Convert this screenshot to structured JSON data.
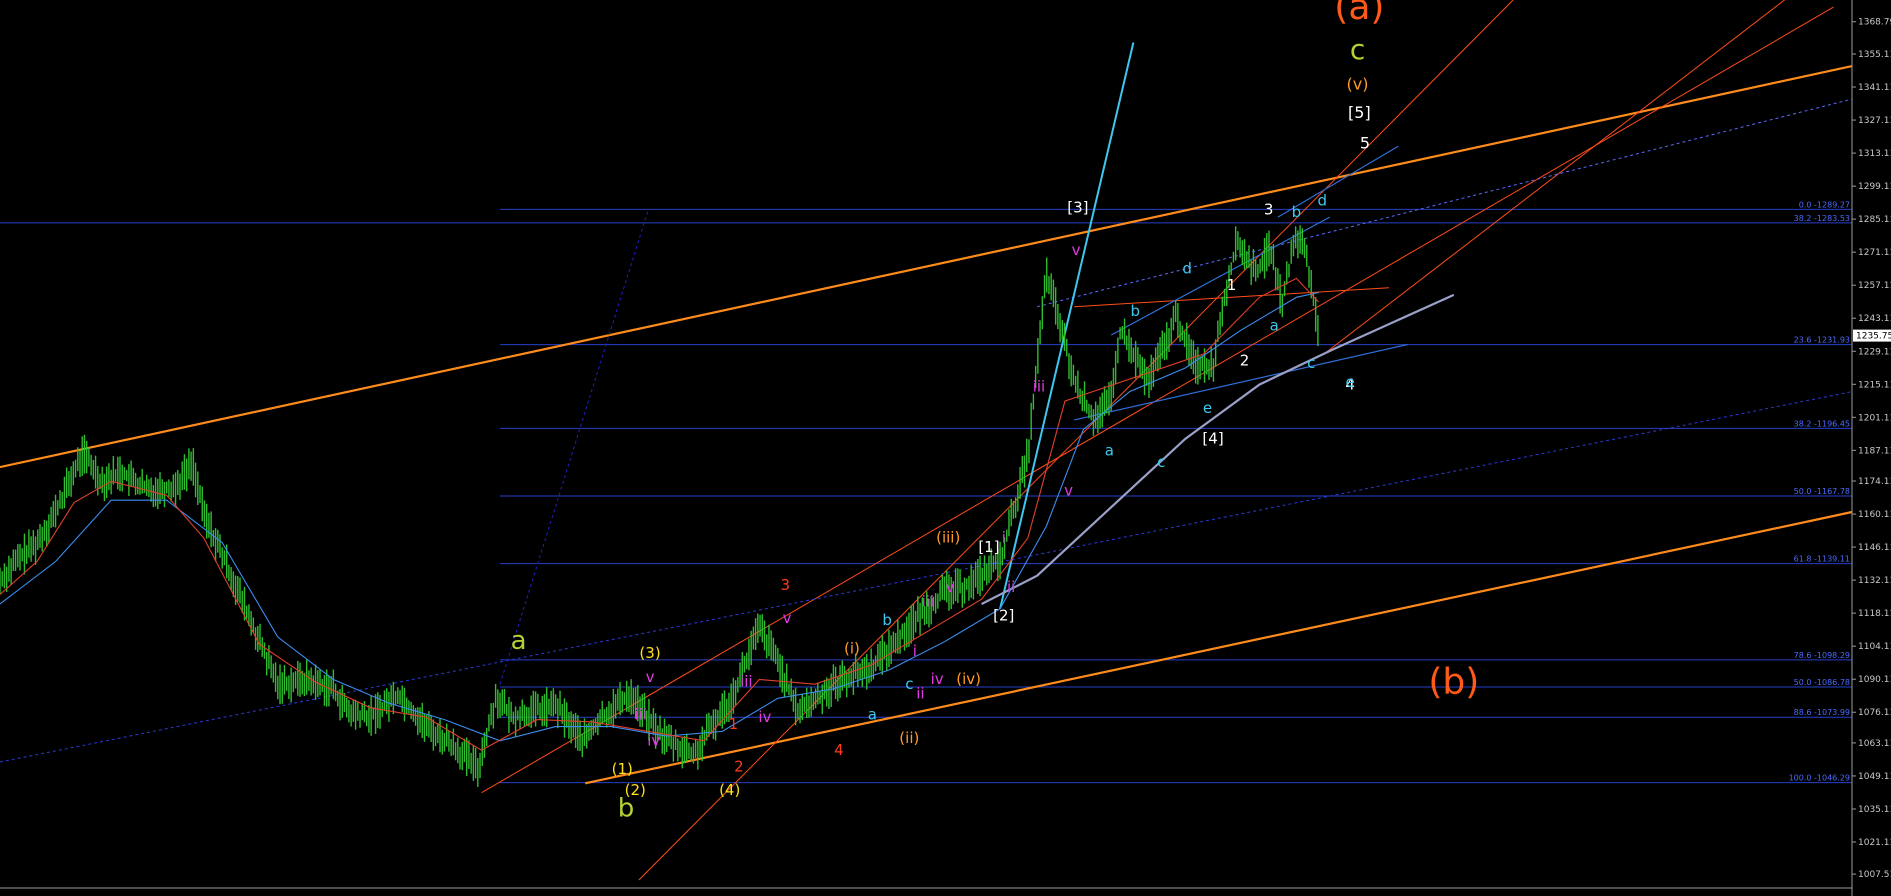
{
  "chart_data": {
    "type": "candlestick",
    "title": "",
    "symbol": "",
    "y_range": [
      1005.0,
      1378.0
    ],
    "x_range": [
      0,
      1000
    ],
    "grid": false,
    "background": "#000000",
    "price_ticks": [
      1368.79,
      1355.11,
      1341.11,
      1327.11,
      1313.11,
      1299.11,
      1285.11,
      1271.11,
      1257.11,
      1243.11,
      1229.11,
      1215.11,
      1201.11,
      1187.11,
      1174.11,
      1160.11,
      1146.11,
      1132.11,
      1118.11,
      1104.11,
      1090.11,
      1076.11,
      1063.11,
      1049.11,
      1035.11,
      1021.11,
      1007.51
    ],
    "price_tick_labels": [
      "1368.79",
      "1355.11",
      "1341.11",
      "1327.11",
      "1313.11",
      "1299.11",
      "1285.11",
      "1271.11",
      "1257.11",
      "1243.11",
      "1229.11",
      "1215.11",
      "1201.11",
      "1187.11",
      "1174.11",
      "1160.11",
      "1146.11",
      "1132.11",
      "1118.11",
      "1104.11",
      "1090.11",
      "1076.11",
      "1063.11",
      "1049.11",
      "1035.11",
      "1021.11",
      "1007.51"
    ],
    "current_price": 1235.75,
    "current_price_label": "1235.75",
    "price_series": [
      [
        0,
        1132
      ],
      [
        10,
        1141
      ],
      [
        20,
        1148
      ],
      [
        30,
        1161
      ],
      [
        40,
        1178
      ],
      [
        45,
        1186
      ],
      [
        55,
        1174
      ],
      [
        65,
        1178
      ],
      [
        80,
        1170
      ],
      [
        95,
        1172
      ],
      [
        104,
        1182
      ],
      [
        110,
        1160
      ],
      [
        125,
        1134
      ],
      [
        140,
        1106
      ],
      [
        150,
        1088
      ],
      [
        165,
        1090
      ],
      [
        180,
        1086
      ],
      [
        188,
        1076
      ],
      [
        200,
        1074
      ],
      [
        215,
        1084
      ],
      [
        230,
        1070
      ],
      [
        245,
        1062
      ],
      [
        258,
        1052
      ],
      [
        268,
        1083
      ],
      [
        276,
        1074
      ],
      [
        300,
        1079
      ],
      [
        315,
        1064
      ],
      [
        325,
        1074
      ],
      [
        340,
        1084
      ],
      [
        355,
        1068
      ],
      [
        365,
        1062
      ],
      [
        375,
        1058
      ],
      [
        385,
        1071
      ],
      [
        395,
        1082
      ],
      [
        410,
        1112
      ],
      [
        420,
        1098
      ],
      [
        430,
        1077
      ],
      [
        438,
        1080
      ],
      [
        450,
        1088
      ],
      [
        470,
        1095
      ],
      [
        480,
        1103
      ],
      [
        495,
        1116
      ],
      [
        510,
        1127
      ],
      [
        520,
        1129
      ],
      [
        540,
        1140
      ],
      [
        555,
        1185
      ],
      [
        565,
        1262
      ],
      [
        572,
        1242
      ],
      [
        580,
        1216
      ],
      [
        590,
        1201
      ],
      [
        600,
        1208
      ],
      [
        605,
        1238
      ],
      [
        620,
        1216
      ],
      [
        630,
        1234
      ],
      [
        635,
        1244
      ],
      [
        645,
        1224
      ],
      [
        655,
        1223
      ],
      [
        660,
        1248
      ],
      [
        668,
        1276
      ],
      [
        678,
        1262
      ],
      [
        686,
        1273
      ],
      [
        692,
        1250
      ],
      [
        700,
        1278
      ],
      [
        705,
        1272
      ],
      [
        712,
        1236
      ]
    ],
    "ma_red": [
      [
        0,
        1126
      ],
      [
        20,
        1140
      ],
      [
        40,
        1165
      ],
      [
        60,
        1174
      ],
      [
        90,
        1168
      ],
      [
        110,
        1150
      ],
      [
        140,
        1105
      ],
      [
        170,
        1089
      ],
      [
        200,
        1078
      ],
      [
        230,
        1074
      ],
      [
        260,
        1060
      ],
      [
        290,
        1073
      ],
      [
        320,
        1072
      ],
      [
        350,
        1068
      ],
      [
        380,
        1064
      ],
      [
        410,
        1090
      ],
      [
        440,
        1088
      ],
      [
        470,
        1096
      ],
      [
        500,
        1110
      ],
      [
        530,
        1124
      ],
      [
        555,
        1150
      ],
      [
        575,
        1208
      ],
      [
        590,
        1212
      ],
      [
        620,
        1220
      ],
      [
        650,
        1228
      ],
      [
        680,
        1252
      ],
      [
        700,
        1260
      ],
      [
        712,
        1250
      ]
    ],
    "ma_blue": [
      [
        0,
        1122
      ],
      [
        30,
        1140
      ],
      [
        60,
        1166
      ],
      [
        90,
        1166
      ],
      [
        120,
        1148
      ],
      [
        150,
        1108
      ],
      [
        180,
        1090
      ],
      [
        210,
        1080
      ],
      [
        240,
        1073
      ],
      [
        270,
        1064
      ],
      [
        300,
        1070
      ],
      [
        330,
        1070
      ],
      [
        360,
        1066
      ],
      [
        390,
        1068
      ],
      [
        420,
        1082
      ],
      [
        450,
        1086
      ],
      [
        480,
        1094
      ],
      [
        510,
        1106
      ],
      [
        540,
        1120
      ],
      [
        565,
        1155
      ],
      [
        585,
        1196
      ],
      [
        610,
        1212
      ],
      [
        640,
        1222
      ],
      [
        670,
        1238
      ],
      [
        700,
        1252
      ],
      [
        712,
        1254
      ]
    ],
    "fibonacci": [
      {
        "level": "0.0",
        "price": 1289.27,
        "label": "0.0 -1289.27"
      },
      {
        "level": "38.2",
        "price": 1283.53,
        "label": "38.2 -1283.53"
      },
      {
        "level": "23.6",
        "price": 1231.93,
        "label": "23.6 -1231.93"
      },
      {
        "level": "38.2",
        "price": 1196.45,
        "label": "38.2 -1196.45"
      },
      {
        "level": "50.0",
        "price": 1167.78,
        "label": "50.0 -1167.78"
      },
      {
        "level": "61.8",
        "price": 1139.11,
        "label": "61.8 -1139.11"
      },
      {
        "level": "78.6",
        "price": 1098.29,
        "label": "78.6 -1098.29"
      },
      {
        "level": "50.0",
        "price": 1086.78,
        "label": "50.0 -1086.78"
      },
      {
        "level": "88.6",
        "price": 1073.99,
        "label": "88.6 -1073.99"
      },
      {
        "level": "100.0",
        "price": 1046.29,
        "label": "100.0 -1046.29"
      }
    ],
    "trendlines": [
      {
        "color": "#ff8c1a",
        "width": 2.2,
        "dash": false,
        "points": [
          [
            0,
            1180
          ],
          [
            1000,
            1350
          ]
        ]
      },
      {
        "color": "#ff8c1a",
        "width": 2.2,
        "dash": false,
        "points": [
          [
            316,
            1046
          ],
          [
            1000,
            1161
          ]
        ]
      },
      {
        "color": "#ff4d1a",
        "width": 1,
        "dash": false,
        "points": [
          [
            345,
            1005
          ],
          [
            817,
            1378
          ]
        ]
      },
      {
        "color": "#ff4d1a",
        "width": 1,
        "dash": false,
        "points": [
          [
            260,
            1042
          ],
          [
            990,
            1375
          ]
        ]
      },
      {
        "color": "#ff4d1a",
        "width": 1,
        "dash": false,
        "points": [
          [
            715,
            1228
          ],
          [
            1000,
            1400
          ]
        ]
      },
      {
        "color": "#ff4d1a",
        "width": 1,
        "dash": false,
        "points": [
          [
            580,
            1248
          ],
          [
            750,
            1256
          ]
        ]
      },
      {
        "color": "#2a3ad8",
        "width": 1,
        "dash": true,
        "points": [
          [
            0,
            1055
          ],
          [
            1000,
            1212
          ]
        ]
      },
      {
        "color": "#5a6aff",
        "width": 1,
        "dash": true,
        "points": [
          [
            560,
            1248
          ],
          [
            1000,
            1336
          ]
        ]
      },
      {
        "color": "#2020c0",
        "width": 1,
        "dash": true,
        "points": [
          [
            270,
            1088
          ],
          [
            350,
            1289
          ]
        ]
      },
      {
        "color": "#2e6fd8",
        "width": 1.2,
        "dash": false,
        "points": [
          [
            600,
            1236
          ],
          [
            718,
            1286
          ]
        ]
      },
      {
        "color": "#2e6fd8",
        "width": 1.2,
        "dash": false,
        "points": [
          [
            580,
            1200
          ],
          [
            760,
            1232
          ]
        ]
      },
      {
        "color": "#2e6fd8",
        "width": 1.2,
        "dash": false,
        "points": [
          [
            690,
            1286
          ],
          [
            755,
            1316
          ]
        ]
      },
      {
        "color": "#3ec8f0",
        "width": 2,
        "dash": false,
        "points": [
          [
            540,
            1120
          ],
          [
            612,
            1360
          ]
        ]
      },
      {
        "color": "#9aa0c8",
        "width": 2.2,
        "dash": false,
        "points": [
          [
            530,
            1122
          ],
          [
            560,
            1134
          ],
          [
            600,
            1163
          ],
          [
            640,
            1192
          ],
          [
            680,
            1215
          ],
          [
            720,
            1230
          ],
          [
            785,
            1253
          ]
        ]
      }
    ],
    "annotations": [
      {
        "text": "(a)",
        "x": 734,
        "y": 1370,
        "color": "#ff5a1a",
        "size": 36
      },
      {
        "text": "c",
        "x": 733,
        "y": 1353,
        "color": "#b3d334",
        "size": 28
      },
      {
        "text": "(v)",
        "x": 733,
        "y": 1340,
        "color": "#ff9a2a",
        "size": 16
      },
      {
        "text": "[5]",
        "x": 734,
        "y": 1328,
        "color": "#ffffff",
        "size": 16
      },
      {
        "text": "5",
        "x": 737,
        "y": 1315,
        "color": "#ffffff",
        "size": 16
      },
      {
        "text": "(b)",
        "x": 785,
        "y": 1084,
        "color": "#ff5a1a",
        "size": 36
      },
      {
        "text": "a",
        "x": 280,
        "y": 1103,
        "color": "#b3d334",
        "size": 26
      },
      {
        "text": "b",
        "x": 338,
        "y": 1032,
        "color": "#b3d334",
        "size": 26
      },
      {
        "text": "[3]",
        "x": 582,
        "y": 1288,
        "color": "#ffffff",
        "size": 15
      },
      {
        "text": "[1]",
        "x": 534,
        "y": 1144,
        "color": "#ffffff",
        "size": 15
      },
      {
        "text": "[2]",
        "x": 542,
        "y": 1115,
        "color": "#ffffff",
        "size": 15
      },
      {
        "text": "[4]",
        "x": 655,
        "y": 1190,
        "color": "#ffffff",
        "size": 15
      },
      {
        "text": "4",
        "x": 729,
        "y": 1213,
        "color": "#ffffff",
        "size": 15
      },
      {
        "text": "3",
        "x": 685,
        "y": 1287,
        "color": "#ffffff",
        "size": 15
      },
      {
        "text": "1",
        "x": 665,
        "y": 1255,
        "color": "#ffffff",
        "size": 15
      },
      {
        "text": "2",
        "x": 672,
        "y": 1223,
        "color": "#ffffff",
        "size": 15
      },
      {
        "text": "(iii)",
        "x": 512,
        "y": 1148,
        "color": "#ff9a2a",
        "size": 15
      },
      {
        "text": "(i)",
        "x": 460,
        "y": 1101,
        "color": "#ff9a2a",
        "size": 15
      },
      {
        "text": "(iv)",
        "x": 523,
        "y": 1088,
        "color": "#ff9a2a",
        "size": 15
      },
      {
        "text": "(ii)",
        "x": 491,
        "y": 1063,
        "color": "#ff9a2a",
        "size": 15
      },
      {
        "text": "3",
        "x": 424,
        "y": 1128,
        "color": "#ff3a1a",
        "size": 15
      },
      {
        "text": "4",
        "x": 453,
        "y": 1058,
        "color": "#ff3a1a",
        "size": 15
      },
      {
        "text": "1",
        "x": 396,
        "y": 1069,
        "color": "#ff3a1a",
        "size": 15
      },
      {
        "text": "2",
        "x": 399,
        "y": 1051,
        "color": "#ff3a1a",
        "size": 15
      },
      {
        "text": "(3)",
        "x": 351,
        "y": 1099,
        "color": "#ffe11a",
        "size": 15
      },
      {
        "text": "(1)",
        "x": 336,
        "y": 1050,
        "color": "#ffe11a",
        "size": 15
      },
      {
        "text": "(2)",
        "x": 343,
        "y": 1041,
        "color": "#ffe11a",
        "size": 15
      },
      {
        "text": "(4)",
        "x": 394,
        "y": 1041,
        "color": "#ffe11a",
        "size": 15
      },
      {
        "text": "v",
        "x": 581,
        "y": 1270,
        "color": "#e23ae2",
        "size": 15
      },
      {
        "text": "iii",
        "x": 561,
        "y": 1212,
        "color": "#e23ae2",
        "size": 15
      },
      {
        "text": "v",
        "x": 577,
        "y": 1168,
        "color": "#e23ae2",
        "size": 15
      },
      {
        "text": "i",
        "x": 542,
        "y": 1148,
        "color": "#e23ae2",
        "size": 15
      },
      {
        "text": "ii",
        "x": 546,
        "y": 1127,
        "color": "#e23ae2",
        "size": 15
      },
      {
        "text": "v",
        "x": 513,
        "y": 1127,
        "color": "#e23ae2",
        "size": 15
      },
      {
        "text": "iii",
        "x": 501,
        "y": 1121,
        "color": "#e23ae2",
        "size": 15
      },
      {
        "text": "iv",
        "x": 506,
        "y": 1088,
        "color": "#e23ae2",
        "size": 15
      },
      {
        "text": "ii",
        "x": 497,
        "y": 1082,
        "color": "#e23ae2",
        "size": 15
      },
      {
        "text": "i",
        "x": 494,
        "y": 1100,
        "color": "#e23ae2",
        "size": 15
      },
      {
        "text": "v",
        "x": 425,
        "y": 1114,
        "color": "#e23ae2",
        "size": 15
      },
      {
        "text": "iii",
        "x": 403,
        "y": 1087,
        "color": "#e23ae2",
        "size": 15
      },
      {
        "text": "iv",
        "x": 413,
        "y": 1072,
        "color": "#e23ae2",
        "size": 15
      },
      {
        "text": "v",
        "x": 351,
        "y": 1089,
        "color": "#e23ae2",
        "size": 15
      },
      {
        "text": "iii",
        "x": 346,
        "y": 1073,
        "color": "#e23ae2",
        "size": 15
      },
      {
        "text": "iv",
        "x": 353,
        "y": 1062,
        "color": "#e23ae2",
        "size": 15
      },
      {
        "text": "d",
        "x": 641,
        "y": 1262,
        "color": "#3ec8f0",
        "size": 15
      },
      {
        "text": "b",
        "x": 613,
        "y": 1244,
        "color": "#3ec8f0",
        "size": 15
      },
      {
        "text": "a",
        "x": 599,
        "y": 1185,
        "color": "#3ec8f0",
        "size": 15
      },
      {
        "text": "c",
        "x": 627,
        "y": 1180,
        "color": "#3ec8f0",
        "size": 15
      },
      {
        "text": "e",
        "x": 652,
        "y": 1203,
        "color": "#3ec8f0",
        "size": 15
      },
      {
        "text": "b",
        "x": 700,
        "y": 1286,
        "color": "#3ec8f0",
        "size": 15
      },
      {
        "text": "d",
        "x": 714,
        "y": 1291,
        "color": "#3ec8f0",
        "size": 15
      },
      {
        "text": "a",
        "x": 688,
        "y": 1238,
        "color": "#3ec8f0",
        "size": 15
      },
      {
        "text": "c",
        "x": 708,
        "y": 1222,
        "color": "#3ec8f0",
        "size": 15
      },
      {
        "text": "e",
        "x": 729,
        "y": 1214,
        "color": "#3ec8f0",
        "size": 15
      },
      {
        "text": "b",
        "x": 479,
        "y": 1113,
        "color": "#3ec8f0",
        "size": 15
      },
      {
        "text": "c",
        "x": 491,
        "y": 1086,
        "color": "#3ec8f0",
        "size": 15
      },
      {
        "text": "a",
        "x": 471,
        "y": 1073,
        "color": "#3ec8f0",
        "size": 15
      }
    ]
  }
}
